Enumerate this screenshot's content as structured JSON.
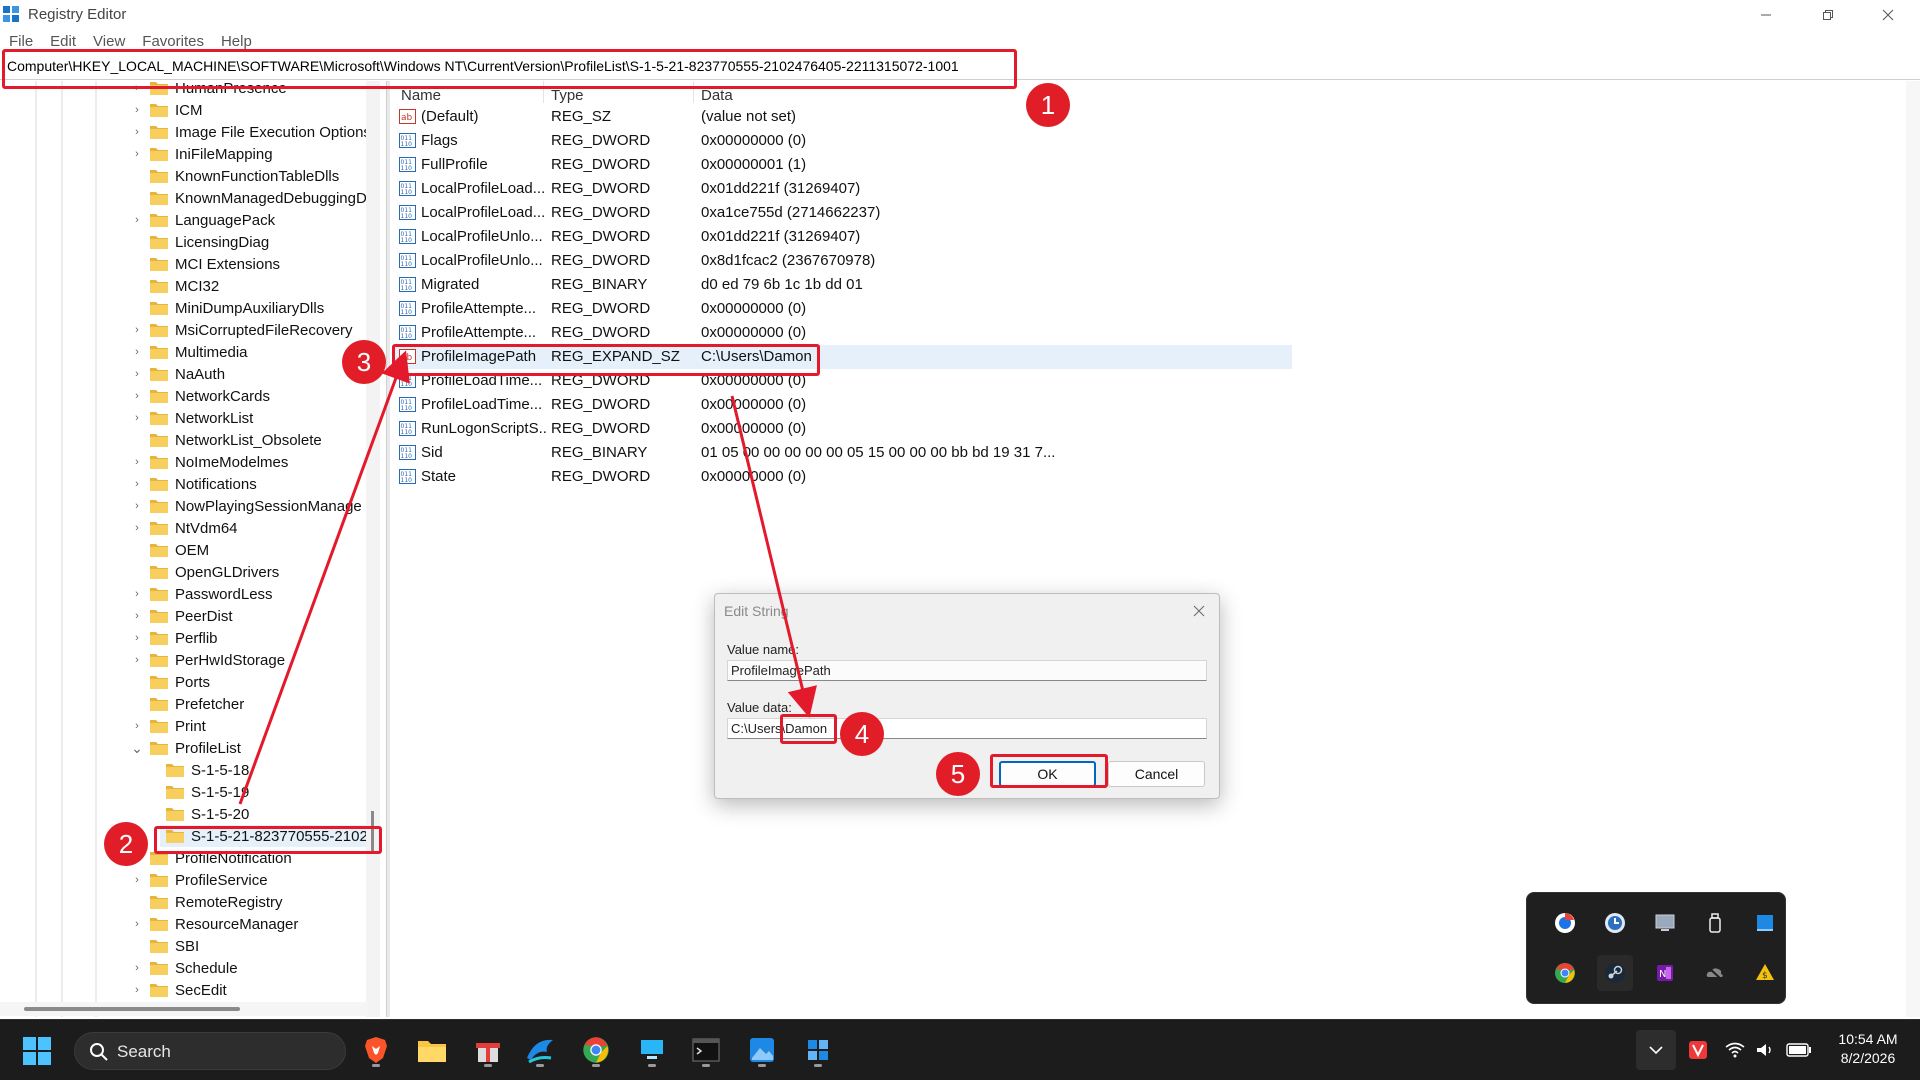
{
  "window": {
    "title": "Registry Editor"
  },
  "menu": [
    "File",
    "Edit",
    "View",
    "Favorites",
    "Help"
  ],
  "address": "Computer\\HKEY_LOCAL_MACHINE\\SOFTWARE\\Microsoft\\Windows NT\\CurrentVersion\\ProfileList\\S-1-5-21-823770555-2102476405-2211315072-1001",
  "tree": [
    {
      "label": "HumanPresence",
      "expandable": true
    },
    {
      "label": "ICM",
      "expandable": true
    },
    {
      "label": "Image File Execution Options",
      "expandable": true
    },
    {
      "label": "IniFileMapping",
      "expandable": true
    },
    {
      "label": "KnownFunctionTableDlls",
      "expandable": false
    },
    {
      "label": "KnownManagedDebuggingD",
      "expandable": false
    },
    {
      "label": "LanguagePack",
      "expandable": true
    },
    {
      "label": "LicensingDiag",
      "expandable": false
    },
    {
      "label": "MCI Extensions",
      "expandable": false
    },
    {
      "label": "MCI32",
      "expandable": false
    },
    {
      "label": "MiniDumpAuxiliaryDlls",
      "expandable": false
    },
    {
      "label": "MsiCorruptedFileRecovery",
      "expandable": true
    },
    {
      "label": "Multimedia",
      "expandable": true
    },
    {
      "label": "NaAuth",
      "expandable": true
    },
    {
      "label": "NetworkCards",
      "expandable": true
    },
    {
      "label": "NetworkList",
      "expandable": true
    },
    {
      "label": "NetworkList_Obsolete",
      "expandable": false
    },
    {
      "label": "NoImeModelmes",
      "expandable": true
    },
    {
      "label": "Notifications",
      "expandable": true
    },
    {
      "label": "NowPlayingSessionManage",
      "expandable": true
    },
    {
      "label": "NtVdm64",
      "expandable": true
    },
    {
      "label": "OEM",
      "expandable": false
    },
    {
      "label": "OpenGLDrivers",
      "expandable": false
    },
    {
      "label": "PasswordLess",
      "expandable": true
    },
    {
      "label": "PeerDist",
      "expandable": true
    },
    {
      "label": "Perflib",
      "expandable": true
    },
    {
      "label": "PerHwIdStorage",
      "expandable": true
    },
    {
      "label": "Ports",
      "expandable": false
    },
    {
      "label": "Prefetcher",
      "expandable": false
    },
    {
      "label": "Print",
      "expandable": true
    },
    {
      "label": "ProfileList",
      "expandable": true,
      "expanded": true
    },
    {
      "label": "S-1-5-18",
      "child": true
    },
    {
      "label": "S-1-5-19",
      "child": true
    },
    {
      "label": "S-1-5-20",
      "child": true
    },
    {
      "label": "S-1-5-21-823770555-2102",
      "child": true,
      "selected": true
    },
    {
      "label": "ProfileNotification",
      "expandable": true
    },
    {
      "label": "ProfileService",
      "expandable": true
    },
    {
      "label": "RemoteRegistry",
      "expandable": false
    },
    {
      "label": "ResourceManager",
      "expandable": true
    },
    {
      "label": "SBI",
      "expandable": false
    },
    {
      "label": "Schedule",
      "expandable": true
    },
    {
      "label": "SecEdit",
      "expandable": true
    }
  ],
  "columns": {
    "name": "Name",
    "type": "Type",
    "data": "Data"
  },
  "values": [
    {
      "name": "(Default)",
      "type": "REG_SZ",
      "data": "(value not set)",
      "icon": "string"
    },
    {
      "name": "Flags",
      "type": "REG_DWORD",
      "data": "0x00000000 (0)",
      "icon": "binary"
    },
    {
      "name": "FullProfile",
      "type": "REG_DWORD",
      "data": "0x00000001 (1)",
      "icon": "binary"
    },
    {
      "name": "LocalProfileLoad...",
      "type": "REG_DWORD",
      "data": "0x01dd221f (31269407)",
      "icon": "binary"
    },
    {
      "name": "LocalProfileLoad...",
      "type": "REG_DWORD",
      "data": "0xa1ce755d (2714662237)",
      "icon": "binary"
    },
    {
      "name": "LocalProfileUnlo...",
      "type": "REG_DWORD",
      "data": "0x01dd221f (31269407)",
      "icon": "binary"
    },
    {
      "name": "LocalProfileUnlo...",
      "type": "REG_DWORD",
      "data": "0x8d1fcac2 (2367670978)",
      "icon": "binary"
    },
    {
      "name": "Migrated",
      "type": "REG_BINARY",
      "data": "d0 ed 79 6b 1c 1b dd 01",
      "icon": "binary"
    },
    {
      "name": "ProfileAttempte...",
      "type": "REG_DWORD",
      "data": "0x00000000 (0)",
      "icon": "binary"
    },
    {
      "name": "ProfileAttempte...",
      "type": "REG_DWORD",
      "data": "0x00000000 (0)",
      "icon": "binary"
    },
    {
      "name": "ProfileImagePath",
      "type": "REG_EXPAND_SZ",
      "data": "C:\\Users\\Damon",
      "icon": "string",
      "selected": true
    },
    {
      "name": "ProfileLoadTime...",
      "type": "REG_DWORD",
      "data": "0x00000000 (0)",
      "icon": "binary"
    },
    {
      "name": "ProfileLoadTime...",
      "type": "REG_DWORD",
      "data": "0x00000000 (0)",
      "icon": "binary"
    },
    {
      "name": "RunLogonScriptS...",
      "type": "REG_DWORD",
      "data": "0x00000000 (0)",
      "icon": "binary"
    },
    {
      "name": "Sid",
      "type": "REG_BINARY",
      "data": "01 05 00 00 00 00 00 05 15 00 00 00 bb bd 19 31 7...",
      "icon": "binary"
    },
    {
      "name": "State",
      "type": "REG_DWORD",
      "data": "0x00000000 (0)",
      "icon": "binary"
    }
  ],
  "dialog": {
    "title": "Edit String",
    "value_name_label": "Value name:",
    "value_name": "ProfileImagePath",
    "value_data_label": "Value data:",
    "value_data": "C:\\Users\\Damon",
    "ok": "OK",
    "cancel": "Cancel"
  },
  "badges": [
    "1",
    "2",
    "3",
    "4",
    "5"
  ],
  "taskbar": {
    "search_label": "Search",
    "time": "10:54 AM",
    "date": "8/2/2026"
  },
  "tray_icons": [
    "chrome-helper-icon",
    "clock-sync-icon",
    "display-icon",
    "usb-icon",
    "windows-security-icon",
    "chrome-icon",
    "steam-icon",
    "onenote-icon",
    "cloud-offline-icon",
    "sticky-dollar-icon"
  ],
  "colors": {
    "annotation": "#e3192c",
    "selection": "#e5f0fb",
    "accent": "#0067c0"
  }
}
